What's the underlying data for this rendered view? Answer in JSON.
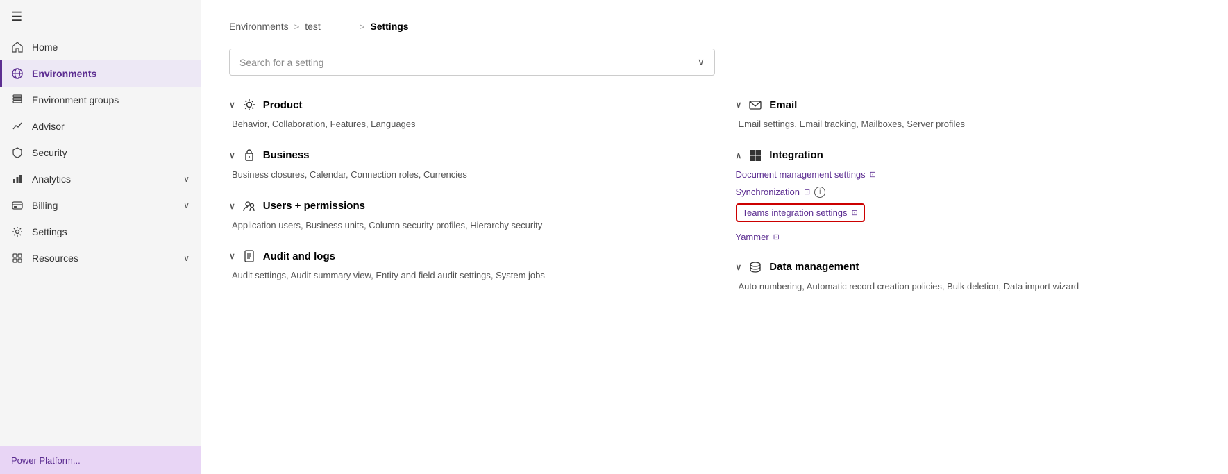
{
  "sidebar": {
    "hamburger": "☰",
    "items": [
      {
        "id": "home",
        "label": "Home",
        "icon": "home",
        "active": false,
        "hasChevron": false
      },
      {
        "id": "environments",
        "label": "Environments",
        "icon": "globe",
        "active": true,
        "hasChevron": false
      },
      {
        "id": "environment-groups",
        "label": "Environment groups",
        "icon": "layers",
        "active": false,
        "hasChevron": false
      },
      {
        "id": "advisor",
        "label": "Advisor",
        "icon": "chart-line",
        "active": false,
        "hasChevron": false
      },
      {
        "id": "security",
        "label": "Security",
        "icon": "shield",
        "active": false,
        "hasChevron": false
      },
      {
        "id": "analytics",
        "label": "Analytics",
        "icon": "analytics",
        "active": false,
        "hasChevron": true
      },
      {
        "id": "billing",
        "label": "Billing",
        "icon": "billing",
        "active": false,
        "hasChevron": true
      },
      {
        "id": "settings",
        "label": "Settings",
        "icon": "gear",
        "active": false,
        "hasChevron": false
      },
      {
        "id": "resources",
        "label": "Resources",
        "icon": "resources",
        "active": false,
        "hasChevron": true
      }
    ],
    "bottom_hint": "Power Platform..."
  },
  "breadcrumb": {
    "environments_label": "Environments",
    "separator1": ">",
    "test_label": "test",
    "redacted": "██████",
    "separator2": ">",
    "current": "Settings"
  },
  "search": {
    "placeholder": "Search for a setting",
    "chevron": "∨"
  },
  "sections": {
    "left": [
      {
        "id": "product",
        "label": "Product",
        "icon": "gear",
        "collapsed": false,
        "items": "Behavior, Collaboration, Features, Languages"
      },
      {
        "id": "business",
        "label": "Business",
        "icon": "business",
        "collapsed": false,
        "items": "Business closures, Calendar, Connection roles, Currencies"
      },
      {
        "id": "users-permissions",
        "label": "Users + permissions",
        "icon": "users",
        "collapsed": false,
        "items": "Application users, Business units, Column security profiles, Hierarchy security"
      },
      {
        "id": "audit-logs",
        "label": "Audit and logs",
        "icon": "audit",
        "collapsed": false,
        "items": "Audit settings, Audit summary view, Entity and field audit settings, System jobs"
      }
    ],
    "right": [
      {
        "id": "email",
        "label": "Email",
        "icon": "email",
        "collapsed": false,
        "items": "Email settings, Email tracking, Mailboxes, Server profiles"
      },
      {
        "id": "integration",
        "label": "Integration",
        "icon": "windows",
        "collapsed": true,
        "links": [
          {
            "id": "doc-management",
            "label": "Document management settings",
            "hasInfo": false,
            "highlighted": false
          },
          {
            "id": "synchronization",
            "label": "Synchronization",
            "hasInfo": true,
            "highlighted": false
          },
          {
            "id": "teams-integration",
            "label": "Teams integration settings",
            "hasInfo": false,
            "highlighted": true
          },
          {
            "id": "yammer",
            "label": "Yammer",
            "hasInfo": false,
            "highlighted": false
          }
        ]
      },
      {
        "id": "data-management",
        "label": "Data management",
        "icon": "data",
        "collapsed": false,
        "items": "Auto numbering, Automatic record creation policies, Bulk deletion, Data import wizard"
      }
    ]
  }
}
